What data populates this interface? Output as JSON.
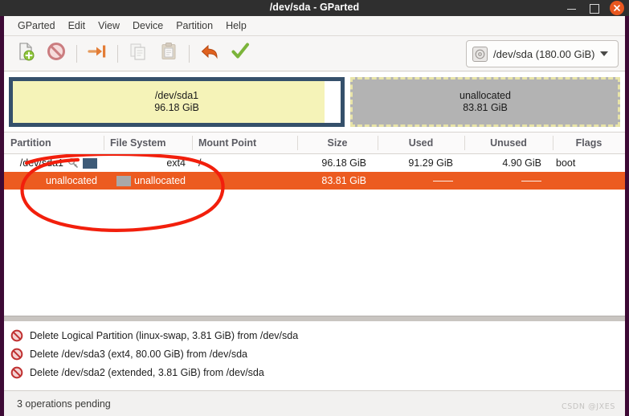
{
  "window": {
    "title": "/dev/sda - GParted",
    "controls": {
      "minimize": "minimize",
      "maximize": "maximize",
      "close": "close"
    }
  },
  "menubar": {
    "items": [
      {
        "label": "GParted"
      },
      {
        "label": "Edit"
      },
      {
        "label": "View"
      },
      {
        "label": "Device"
      },
      {
        "label": "Partition"
      },
      {
        "label": "Help"
      }
    ]
  },
  "toolbar": {
    "buttons": [
      {
        "name": "new-partition-button",
        "icon": "new-document-icon",
        "enabled": true
      },
      {
        "name": "delete-partition-button",
        "icon": "delete-prohibition-icon",
        "enabled": true
      },
      {
        "name": "resize-move-button",
        "icon": "resize-arrow-icon",
        "enabled": true
      },
      {
        "name": "copy-button",
        "icon": "copy-icon",
        "enabled": false
      },
      {
        "name": "paste-button",
        "icon": "paste-icon",
        "enabled": false
      },
      {
        "name": "undo-button",
        "icon": "undo-arrow-icon",
        "enabled": true
      },
      {
        "name": "apply-button",
        "icon": "apply-check-icon",
        "enabled": true
      }
    ],
    "device_selector": {
      "label": "/dev/sda (180.00 GiB)",
      "icon": "disk-icon"
    }
  },
  "graphic": {
    "blocks": [
      {
        "name": "/dev/sda1",
        "size": "96.18 GiB",
        "style": "ext4",
        "selected": false
      },
      {
        "name": "unallocated",
        "size": "83.81 GiB",
        "style": "unallocated",
        "selected": true
      }
    ]
  },
  "table": {
    "headers": {
      "partition": "Partition",
      "filesystem": "File System",
      "mountpoint": "Mount Point",
      "size": "Size",
      "used": "Used",
      "unused": "Unused",
      "flags": "Flags"
    },
    "rows": [
      {
        "partition": "/dev/sda1",
        "filesystem": "ext4",
        "mountpoint": "/",
        "size": "96.18 GiB",
        "used": "91.29 GiB",
        "unused": "4.90 GiB",
        "flags": "boot",
        "selected": false,
        "has_key_icon": true,
        "swatch_color": "#3e5b78"
      },
      {
        "partition": "unallocated",
        "filesystem": "unallocated",
        "mountpoint": "",
        "size": "83.81 GiB",
        "used": "——",
        "unused": "——",
        "flags": "",
        "selected": true,
        "has_key_icon": false,
        "swatch_color": "#a9a9a9"
      }
    ]
  },
  "operations": {
    "items": [
      {
        "text": "Delete Logical Partition (linux-swap, 3.81 GiB) from /dev/sda"
      },
      {
        "text": "Delete /dev/sda3 (ext4, 80.00 GiB) from /dev/sda"
      },
      {
        "text": "Delete /dev/sda2 (extended, 3.81 GiB) from /dev/sda"
      }
    ]
  },
  "statusbar": {
    "text": "3 operations pending",
    "watermark": "CSDN @JXES"
  },
  "colors": {
    "selection": "#ec5b20",
    "titlebar": "#2f2f2f",
    "close_button": "#e8571f",
    "annotation": "#f21f0c",
    "window_border": "#3d0a35",
    "ext4_swatch": "#3e5b78",
    "unallocated_swatch": "#a9a9a9",
    "partition_fill": "#f5f3b8"
  }
}
